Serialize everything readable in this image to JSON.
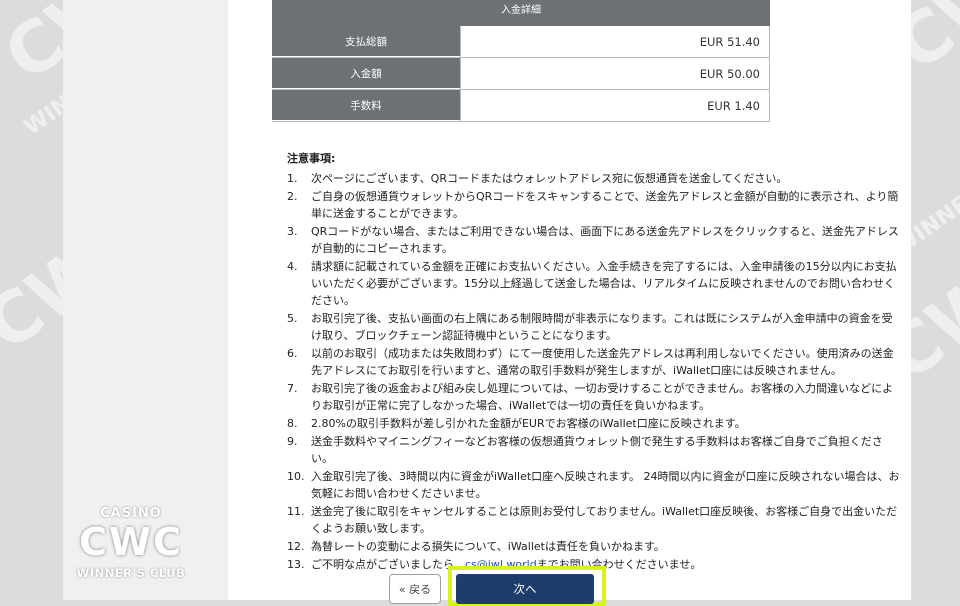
{
  "details": {
    "header": "入金詳細",
    "rows": [
      {
        "label": "支払総額",
        "value": "EUR 51.40"
      },
      {
        "label": "入金額",
        "value": "EUR 50.00"
      },
      {
        "label": "手数料",
        "value": "EUR 1.40"
      }
    ]
  },
  "notes": {
    "title": "注意事項:",
    "items": [
      {
        "num": "1.",
        "text": "次ページにございます、QRコードまたはウォレットアドレス宛に仮想通貨を送金してください。"
      },
      {
        "num": "2.",
        "text": "ご自身の仮想通貨ウォレットからQRコードをスキャンすることで、送金先アドレスと金額が自動的に表示され、より簡単に送金することができます。"
      },
      {
        "num": "3.",
        "text": "QRコードがない場合、またはご利用できない場合は、画面下にある送金先アドレスをクリックすると、送金先アドレスが自動的にコピーされます。"
      },
      {
        "num": "4.",
        "text": "請求額に記載されている金額を正確にお支払いください。入金手続きを完了するには、入金申請後の15分以内にお支払いいただく必要がございます。15分以上経過して送金した場合は、リアルタイムに反映されませんのでお問い合わせください。"
      },
      {
        "num": "5.",
        "text": "お取引完了後、支払い画面の右上隅にある制限時間が非表示になります。これは既にシステムが入金申請中の資金を受け取り、ブロックチェーン認証待機中ということになります。"
      },
      {
        "num": "6.",
        "text": "以前のお取引（成功または失敗問わず）にて一度使用した送金先アドレスは再利用しないでください。使用済みの送金先アドレスにてお取引を行いますと、通常の取引手数料が発生しますが、iWallet口座には反映されません。"
      },
      {
        "num": "7.",
        "text": "お取引完了後の返金および組み戻し処理については、一切お受けすることができません。お客様の入力間違いなどによりお取引が正常に完了しなかった場合、iWalletでは一切の責任を負いかねます。"
      },
      {
        "num": "8.",
        "text": "2.80%の取引手数料が差し引かれた金額がEURでお客様のiWallet口座に反映されます。"
      },
      {
        "num": "9.",
        "text": "送金手数料やマイニングフィーなどお客様の仮想通貨ウォレット側で発生する手数料はお客様ご自身でご負担ください。"
      },
      {
        "num": "10.",
        "text": "入金取引完了後、3時間以内に資金がiWallet口座へ反映されます。 24時間以内に資金が口座に反映されない場合は、お気軽にお問い合わせくださいませ。"
      },
      {
        "num": "11.",
        "text": "送金完了後に取引をキャンセルすることは原則お受付しておりません。iWallet口座反映後、お客様ご自身で出金いただくようお願い致します。"
      },
      {
        "num": "12.",
        "text": "為替レートの変動による損失について、iWalletは責任を負いかねます。"
      }
    ],
    "last": {
      "num": "13.",
      "prefix": "ご不明な点がございましたら、",
      "email": "cs@iwl.world",
      "suffix": "までお問い合わせくださいませ。"
    }
  },
  "buttons": {
    "back": "« 戻る",
    "next": "次へ"
  },
  "logo": {
    "casino": "CASINO",
    "cwc": "CWC",
    "winners": "WINNER'S CLUB"
  },
  "watermark": {
    "mark": "CWC",
    "sub": "WINNER'S CLUB"
  },
  "colors": {
    "header_bg": "#6d7173",
    "next_bg": "#1d3d6b",
    "highlight": "#d8f21c",
    "link": "#1a4fb0"
  }
}
